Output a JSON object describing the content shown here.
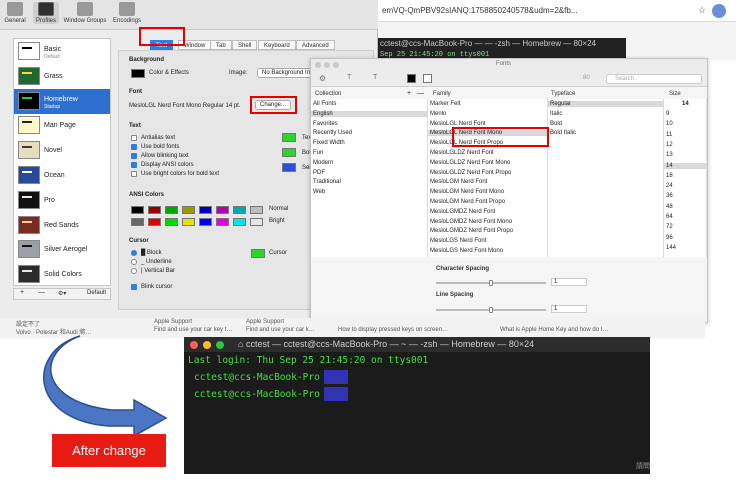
{
  "browser": {
    "url": "emVQ-QmPBV92sIANQ:1758850240578&udm=2&fb..."
  },
  "terminal_back": {
    "title": "cctest@ccs-MacBook-Pro — — -zsh — Homebrew — 80×24",
    "line": "Sep 25 21:45:20 on ttys001"
  },
  "settings": {
    "toolbar": [
      "General",
      "Profiles",
      "Window Groups",
      "Encodings"
    ],
    "tabs": [
      "Text",
      "Window",
      "Tab",
      "Shell",
      "Keyboard",
      "Advanced"
    ],
    "profiles": [
      {
        "name": "Basic",
        "sub": "Default",
        "bg": "#ffffff",
        "fg": "#000000"
      },
      {
        "name": "Grass",
        "sub": "",
        "bg": "#1e6a2e",
        "fg": "#ffd24c"
      },
      {
        "name": "Homebrew",
        "sub": "Startup",
        "bg": "#000000",
        "fg": "#27d427"
      },
      {
        "name": "Man Page",
        "sub": "",
        "bg": "#fff7c9",
        "fg": "#222222"
      },
      {
        "name": "Novel",
        "sub": "",
        "bg": "#e8dcc0",
        "fg": "#4a3520"
      },
      {
        "name": "Ocean",
        "sub": "",
        "bg": "#244a9a",
        "fg": "#ffffff"
      },
      {
        "name": "Pro",
        "sub": "",
        "bg": "#111111",
        "fg": "#e8e8e8"
      },
      {
        "name": "Red Sands",
        "sub": "",
        "bg": "#7a2a1e",
        "fg": "#e8d2a0"
      },
      {
        "name": "Silver Aerogel",
        "sub": "",
        "bg": "#9aa0a8",
        "fg": "#111111"
      },
      {
        "name": "Solid Colors",
        "sub": "",
        "bg": "#2c2c2c",
        "fg": "#e8e8e8"
      }
    ],
    "footer": {
      "add": "+",
      "remove": "—",
      "more": "⚙▾",
      "default": "Default"
    },
    "background_label": "Background",
    "color_effects": "Color & Effects",
    "image_label": "Image:",
    "image_value": "No Background Image",
    "font_label": "Font",
    "font_value": "MesloLGL Nerd Font Mono Regular 14 pt.",
    "change_button": "Change...",
    "text_label": "Text",
    "options": [
      {
        "label": "Antialias text",
        "on": false
      },
      {
        "label": "Use bold fonts",
        "on": true
      },
      {
        "label": "Allow blinking text",
        "on": true
      },
      {
        "label": "Display ANSI colors",
        "on": true
      },
      {
        "label": "Use bright colors for bold text",
        "on": false
      }
    ],
    "text_colors": [
      {
        "label": "Text",
        "color": "#2bd62b"
      },
      {
        "label": "Bold Text",
        "color": "#2bd62b"
      },
      {
        "label": "Selection",
        "color": "#2a4fd8"
      }
    ],
    "ansi_label": "ANSI Colors",
    "ansi_normal": [
      "#000000",
      "#990000",
      "#00a600",
      "#999900",
      "#0000b2",
      "#b200b2",
      "#00a6b2",
      "#bfbfbf"
    ],
    "ansi_bright": [
      "#666666",
      "#e50000",
      "#00d900",
      "#e5e500",
      "#0000ff",
      "#e500e5",
      "#00e5e5",
      "#e5e5e5"
    ],
    "normal_label": "Normal",
    "bright_label": "Bright",
    "cursor_label": "Cursor",
    "cursor_options": [
      {
        "label": "█ Block",
        "on": true
      },
      {
        "label": "_ Underline",
        "on": false
      },
      {
        "label": "| Vertical Bar",
        "on": false
      }
    ],
    "blink_cursor": "Blink cursor",
    "cursor_color_label": "Cursor",
    "cursor_color": "#2bd62b"
  },
  "fonts": {
    "title": "Fonts",
    "search_placeholder": "Search",
    "size_field": "80",
    "headers": [
      "Collection",
      "Family",
      "Typeface",
      "Size"
    ],
    "collections": [
      "All Fonts",
      "English",
      "Favorites",
      "Recently Used",
      "Fixed Width",
      "Fun",
      "Modern",
      "PDF",
      "Traditional",
      "Web"
    ],
    "families": [
      "Marker Felt",
      "Menlo",
      "MesloLGL Nerd Font",
      "MesloLGL Nerd Font Mono",
      "MesloLGL Nerd Font Propo",
      "MesloLGLDZ Nerd Font",
      "MesloLGLDZ Nerd Font Mono",
      "MesloLGLDZ Nerd Font Propo",
      "MesloLGM Nerd Font",
      "MesloLGM Nerd Font Mono",
      "MesloLGM Nerd Font Propo",
      "MesloLGMDZ Nerd Font",
      "MesloLGMDZ Nerd Font Mono",
      "MesloLGMDZ Nerd Font Propo",
      "MesloLGS Nerd Font",
      "MesloLGS Nerd Font Mono"
    ],
    "typefaces": [
      "Regular",
      "Italic",
      "Bold",
      "Bold Italic"
    ],
    "size_value": "14",
    "sizes": [
      "9",
      "10",
      "11",
      "12",
      "13",
      "14",
      "18",
      "24",
      "36",
      "48",
      "64",
      "72",
      "96",
      "144"
    ],
    "char_spacing": "Character Spacing",
    "line_spacing": "Line Spacing",
    "char_value": "1",
    "line_value": "1"
  },
  "bookmarks": [
    "設定不了",
    "Volvo · Polestar 和Audi 將…",
    "Apple Support",
    "Find and use your car key t…",
    "Apple Support",
    "Find and use your car k…",
    "How to display pressed keys on screen…",
    "What is Apple Home Key and how do I…"
  ],
  "terminal": {
    "title": "cctest — cctest@ccs-MacBook-Pro — ~ — -zsh — Homebrew — 80×24",
    "last_login": "Last login: Thu Sep 25 21:45:20 on ttys001",
    "prompt1": "cctest@ccs-MacBook-Pro",
    "prompt2": "cctest@ccs-MacBook-Pro",
    "side_char": "請問"
  },
  "after_label": "After change",
  "colors": {
    "highlight": "#e60000",
    "selected": "#2f6fd0",
    "terminal_green": "#3fe23f",
    "prompt_block": "#2f33b4",
    "arrow_blue": "#4a76c4"
  }
}
